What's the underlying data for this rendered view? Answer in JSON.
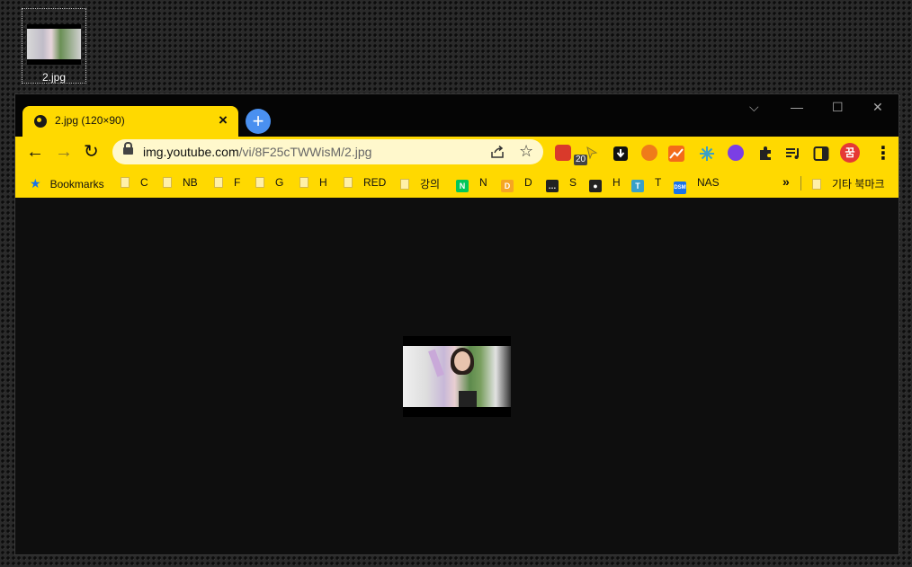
{
  "desktop": {
    "icon_label": "2.jpg"
  },
  "tab": {
    "title": "2.jpg (120×90)",
    "close": "×"
  },
  "newtab": {
    "label": "+"
  },
  "window_controls": {
    "dropdown": "⌵",
    "minimize": "—",
    "maximize": "☐",
    "close": "✕"
  },
  "nav": {
    "back": "←",
    "forward": "→",
    "reload": "↻"
  },
  "omnibox": {
    "host": "img.youtube.com",
    "path": "/vi/8F25cTWWisM/2.jpg",
    "share_icon": "share-icon",
    "star_icon": "☆"
  },
  "extensions": {
    "badge": "20",
    "colors": [
      "#d93a2b",
      "#f2c200",
      "#111111",
      "#ef7b1a",
      "#f36b1a",
      "#3aa0c8",
      "#7b3fe4",
      "#222222",
      "#222222",
      "#222222",
      "#e53935"
    ],
    "puzzle": "puzzle-icon",
    "profile": "꿈",
    "menu": "⋮"
  },
  "bookmarks": {
    "star_label": "Bookmarks",
    "items": [
      {
        "label": "C",
        "kind": "folder"
      },
      {
        "label": "NB",
        "kind": "folder"
      },
      {
        "label": "F",
        "kind": "folder"
      },
      {
        "label": "G",
        "kind": "folder"
      },
      {
        "label": "H",
        "kind": "folder"
      },
      {
        "label": "RED",
        "kind": "folder"
      },
      {
        "label": "강의",
        "kind": "folder"
      },
      {
        "label": "N",
        "kind": "site",
        "icon": "N",
        "color": "#03c75a"
      },
      {
        "label": "D",
        "kind": "site",
        "icon": "D",
        "color": "#f5a623"
      },
      {
        "label": "S",
        "kind": "site",
        "icon": "…",
        "color": "#222222"
      },
      {
        "label": "H",
        "kind": "site",
        "icon": "●",
        "color": "#222222"
      },
      {
        "label": "T",
        "kind": "site",
        "icon": "T",
        "color": "#3aa0c8"
      },
      {
        "label": "NAS",
        "kind": "site",
        "icon": "DSM",
        "color": "#1a73e8"
      }
    ],
    "overflow": "»",
    "other_label": "기타 북마크"
  }
}
